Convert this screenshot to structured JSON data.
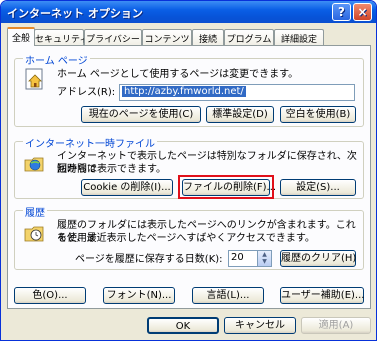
{
  "window": {
    "title": "インターネット オプション",
    "help_glyph": "?",
    "close_glyph": "×"
  },
  "tabs": [
    {
      "label": "全般"
    },
    {
      "label": "セキュリティ"
    },
    {
      "label": "プライバシー"
    },
    {
      "label": "コンテンツ"
    },
    {
      "label": "接続"
    },
    {
      "label": "プログラム"
    },
    {
      "label": "詳細設定"
    }
  ],
  "homepage": {
    "title": "ホーム ページ",
    "description": "ホーム ページとして使用するページは変更できます。",
    "address_label": "アドレス(R):",
    "address_value": "http://azby.fmworld.net/",
    "buttons": {
      "current": "現在のページを使用(C)",
      "default": "標準設定(D)",
      "blank": "空白を使用(B)"
    },
    "icon": "home-page-icon"
  },
  "temp_files": {
    "title": "インターネット一時ファイル",
    "description_line1": "インターネットで表示したページは特別なフォルダに保存され、次回からは",
    "description_line2": "短時間で表示できます。",
    "buttons": {
      "cookie": "Cookie の削除(I)...",
      "delete_files": "ファイルの削除(F)...",
      "settings": "設定(S)..."
    },
    "icon": "temp-files-icon"
  },
  "history": {
    "title": "履歴",
    "description_line1": "履歴のフォルダには表示したページへのリンクが含まれます。これを使用す",
    "description_line2": "ると、最近表示したページへすばやくアクセスできます。",
    "days_label": "ページを履歴に保存する日数(K):",
    "days_value": "20",
    "clear_button": "履歴のクリア(H)",
    "icon": "history-icon"
  },
  "bottom_buttons": {
    "colors": "色(O)...",
    "fonts": "フォント(N)...",
    "languages": "言語(L)...",
    "accessibility": "ユーザー補助(E)..."
  },
  "dialog_buttons": {
    "ok": "OK",
    "cancel": "キャンセル",
    "apply": "適用(A)"
  },
  "colors": {
    "title_bar": "#0a5fe6",
    "group_title": "#0046d5",
    "highlight": "#e0101a",
    "active_tab_accent": "#e68b2c",
    "selection": "#316ac5"
  }
}
